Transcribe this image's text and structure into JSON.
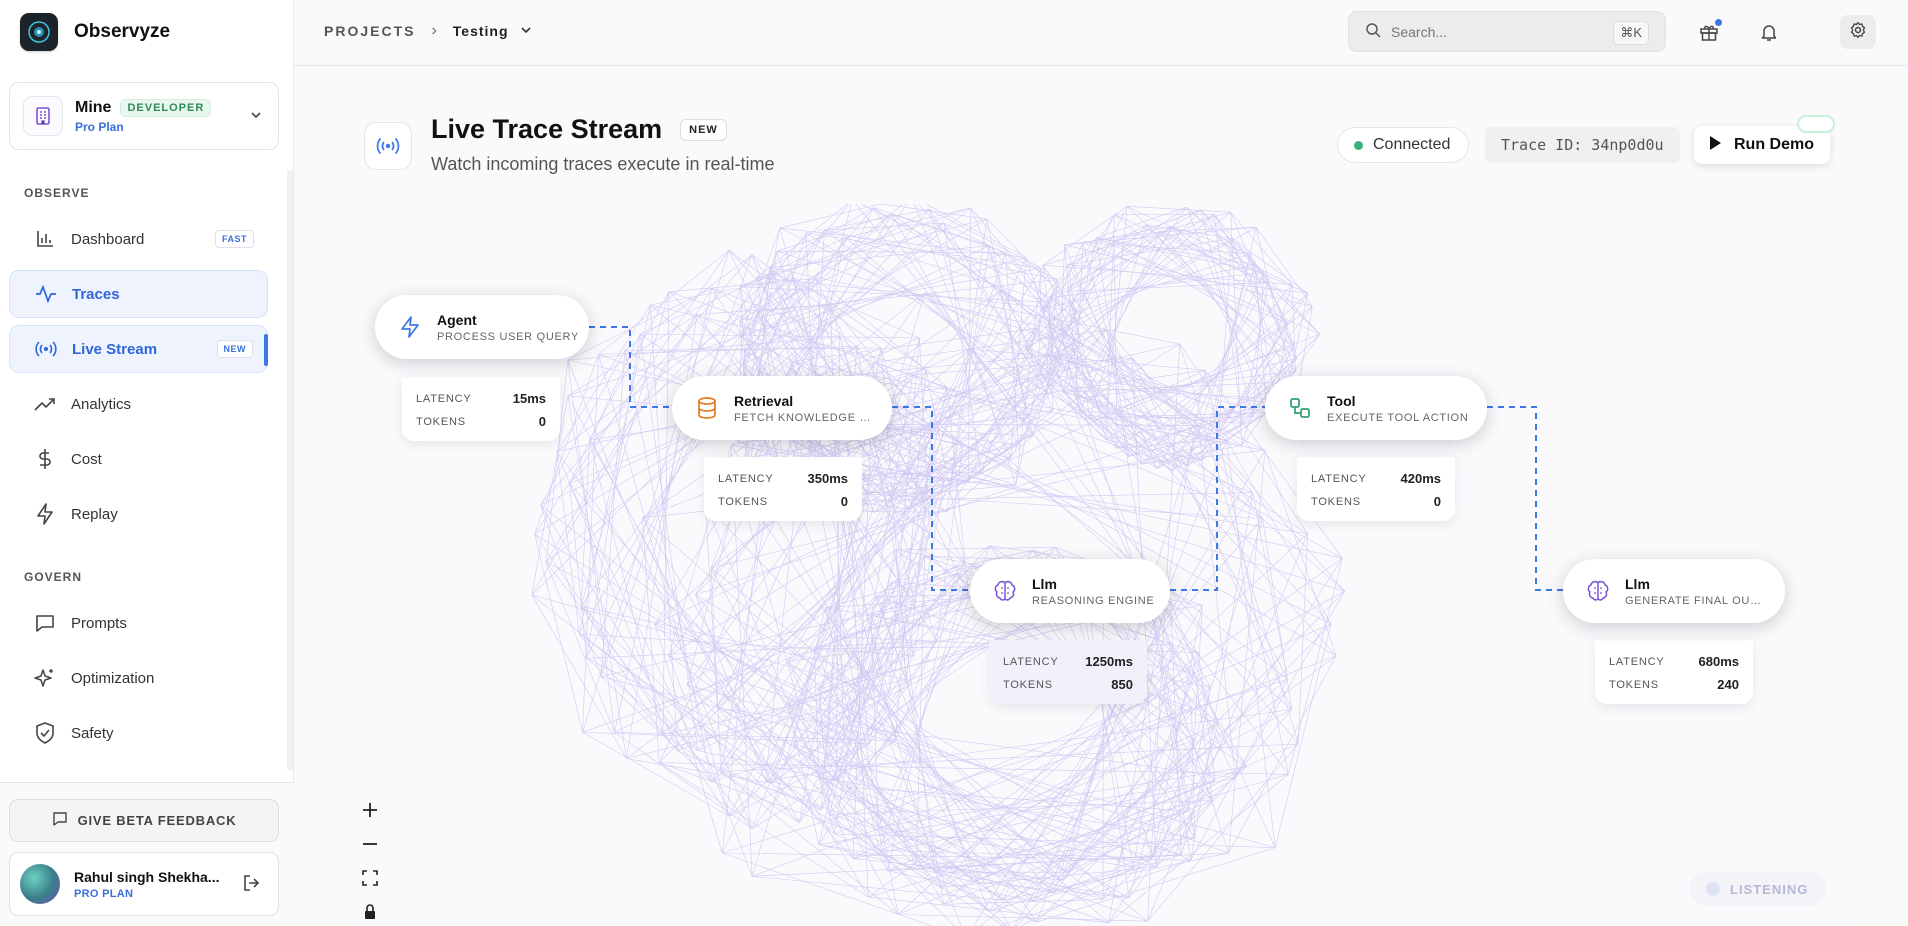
{
  "app": {
    "name": "Observyze"
  },
  "workspace": {
    "name": "Mine",
    "badge": "DEVELOPER",
    "plan": "Pro Plan"
  },
  "nav": {
    "observe_label": "OBSERVE",
    "govern_label": "GOVERN",
    "items": [
      {
        "label": "Dashboard",
        "pill": "FAST"
      },
      {
        "label": "Traces"
      },
      {
        "label": "Live Stream",
        "pill": "NEW"
      },
      {
        "label": "Analytics"
      },
      {
        "label": "Cost"
      },
      {
        "label": "Replay"
      },
      {
        "label": "Prompts"
      },
      {
        "label": "Optimization"
      },
      {
        "label": "Safety"
      }
    ]
  },
  "footer": {
    "feedback_label": "GIVE BETA FEEDBACK",
    "user_name": "Rahul singh Shekha...",
    "user_plan": "PRO PLAN"
  },
  "topbar": {
    "crumb_root": "PROJECTS",
    "crumb_sep": "›",
    "project": "Testing",
    "search_placeholder": "Search...",
    "search_kbd": "⌘K"
  },
  "page": {
    "title": "Live Trace Stream",
    "title_badge": "NEW",
    "subtitle": "Watch incoming traces execute in real-time",
    "status": "Connected",
    "trace_id": "Trace ID: 34np0d0u",
    "run_label": "Run Demo",
    "listening_label": "LISTENING"
  },
  "metric_labels": {
    "latency": "LATENCY",
    "tokens": "TOKENS"
  },
  "trace_nodes": [
    {
      "type": "Agent",
      "action": "PROCESS USER QUERY",
      "latency": "15ms",
      "tokens": "0"
    },
    {
      "type": "Retrieval",
      "action": "FETCH KNOWLEDGE B...",
      "latency": "350ms",
      "tokens": "0"
    },
    {
      "type": "Llm",
      "action": "REASONING ENGINE",
      "latency": "1250ms",
      "tokens": "850"
    },
    {
      "type": "Tool",
      "action": "EXECUTE TOOL ACTION",
      "latency": "420ms",
      "tokens": "0"
    },
    {
      "type": "Llm",
      "action": "GENERATE FINAL OUT...",
      "latency": "680ms",
      "tokens": "240"
    }
  ],
  "colors": {
    "accent": "#3c78e6",
    "connected": "#3ab37a",
    "mesh": "#8b6fe0"
  }
}
